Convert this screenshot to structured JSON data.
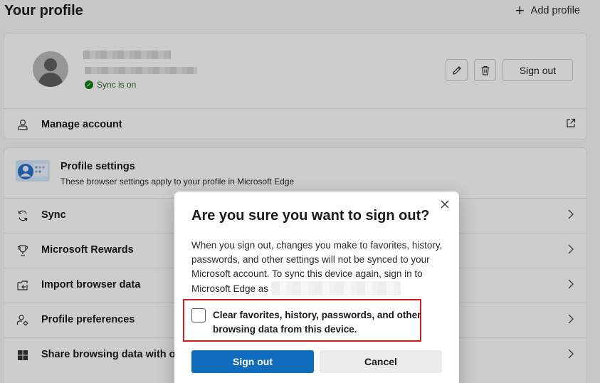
{
  "header": {
    "title": "Your profile",
    "add_profile_label": "Add profile"
  },
  "profile": {
    "sync_status": "Sync is on",
    "sign_out_label": "Sign out",
    "manage_account_label": "Manage account"
  },
  "settings": {
    "title": "Profile settings",
    "subtitle": "These browser settings apply to your profile in Microsoft Edge",
    "items": [
      {
        "label": "Sync",
        "icon": "sync-icon"
      },
      {
        "label": "Microsoft Rewards",
        "icon": "trophy-icon"
      },
      {
        "label": "Import browser data",
        "icon": "import-icon"
      },
      {
        "label": "Profile preferences",
        "icon": "profile-prefs-icon"
      },
      {
        "label": "Share browsing data with other Windows features",
        "icon": "windows-icon"
      }
    ]
  },
  "dialog": {
    "title": "Are you sure you want to sign out?",
    "body": "When you sign out, changes you make to favorites, history, passwords, and other settings will not be synced to your Microsoft account. To sync this device again, sign in to Microsoft Edge as",
    "checkbox_label": "Clear favorites, history, passwords, and other browsing data from this device.",
    "checkbox_checked": false,
    "sign_out_label": "Sign out",
    "cancel_label": "Cancel"
  },
  "colors": {
    "accent": "#0f6cbd",
    "sync_green": "#107c10",
    "highlight_red": "#d11f1f"
  }
}
